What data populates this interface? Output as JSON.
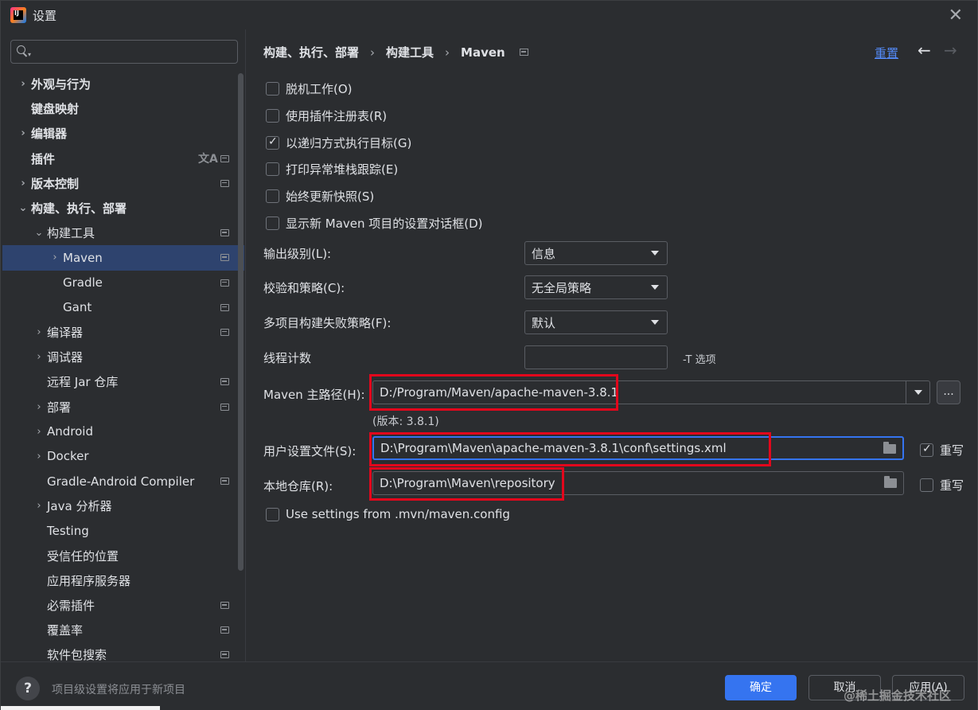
{
  "window": {
    "title": "设置",
    "logo_text": "IJ"
  },
  "sidebar": {
    "search_placeholder": "",
    "items": [
      {
        "label": "外观与行为",
        "chevron": "›",
        "bold": true
      },
      {
        "label": "键盘映射",
        "chevron": "",
        "bold": true
      },
      {
        "label": "编辑器",
        "chevron": "›",
        "bold": true
      },
      {
        "label": "插件",
        "chevron": "",
        "bold": true
      },
      {
        "label": "版本控制",
        "chevron": "›",
        "bold": true
      },
      {
        "label": "构建、执行、部署",
        "chevron": "⌄",
        "bold": true
      },
      {
        "label": "构建工具",
        "chevron": "⌄",
        "bold": false
      },
      {
        "label": "Maven",
        "chevron": "›",
        "bold": false
      },
      {
        "label": "Gradle",
        "chevron": "",
        "bold": false
      },
      {
        "label": "Gant",
        "chevron": "",
        "bold": false
      },
      {
        "label": "编译器",
        "chevron": "›",
        "bold": false
      },
      {
        "label": "调试器",
        "chevron": "›",
        "bold": false
      },
      {
        "label": "远程 Jar 仓库",
        "chevron": "",
        "bold": false
      },
      {
        "label": "部署",
        "chevron": "›",
        "bold": false
      },
      {
        "label": "Android",
        "chevron": "›",
        "bold": false
      },
      {
        "label": "Docker",
        "chevron": "›",
        "bold": false
      },
      {
        "label": "Gradle-Android Compiler",
        "chevron": "",
        "bold": false
      },
      {
        "label": "Java 分析器",
        "chevron": "›",
        "bold": false
      },
      {
        "label": "Testing",
        "chevron": "",
        "bold": false
      },
      {
        "label": "受信任的位置",
        "chevron": "",
        "bold": false
      },
      {
        "label": "应用程序服务器",
        "chevron": "",
        "bold": false
      },
      {
        "label": "必需插件",
        "chevron": "",
        "bold": false
      },
      {
        "label": "覆盖率",
        "chevron": "",
        "bold": false
      },
      {
        "label": "软件包搜索",
        "chevron": "",
        "bold": false
      }
    ],
    "translate_glyph": "文A"
  },
  "main": {
    "breadcrumb": [
      "构建、执行、部署",
      "构建工具",
      "Maven"
    ],
    "breadcrumb_sep": "›",
    "reset_label": "重置",
    "back_glyph": "←",
    "forward_glyph": "→",
    "checkboxes": [
      {
        "label": "脱机工作(O)",
        "checked": false
      },
      {
        "label": "使用插件注册表(R)",
        "checked": false
      },
      {
        "label": "以递归方式执行目标(G)",
        "checked": true
      },
      {
        "label": "打印异常堆栈跟踪(E)",
        "checked": false
      },
      {
        "label": "始终更新快照(S)",
        "checked": false
      },
      {
        "label": "显示新 Maven 项目的设置对话框(D)",
        "checked": false
      }
    ],
    "output_level": {
      "label": "输出级别(L):",
      "value": "信息"
    },
    "checksum_policy": {
      "label": "校验和策略(C):",
      "value": "无全局策略"
    },
    "multiproject_fail": {
      "label": "多项目构建失败策略(F):",
      "value": "默认"
    },
    "thread_count": {
      "label": "线程计数",
      "value": "",
      "hint": "-T 选项"
    },
    "maven_home": {
      "label": "Maven 主路径(H):",
      "value": "D:/Program/Maven/apache-maven-3.8.1",
      "browse": "...",
      "version": "(版本: 3.8.1)"
    },
    "user_settings": {
      "label": "用户设置文件(S):",
      "value": "D:\\Program\\Maven\\apache-maven-3.8.1\\conf\\settings.xml",
      "override_label": "重写",
      "override_checked": true
    },
    "local_repo": {
      "label": "本地仓库(R):",
      "value": "D:\\Program\\Maven\\repository",
      "override_label": "重写",
      "override_checked": false
    },
    "mvn_config": {
      "label": "Use settings from .mvn/maven.config",
      "checked": false
    }
  },
  "footer": {
    "help_glyph": "?",
    "note": "项目级设置将应用于新项目",
    "ok_label": "确定",
    "cancel_label": "取消",
    "apply_label": "应用(A)",
    "watermark": "@稀土掘金技术社区"
  },
  "colors": {
    "accent": "#3574f0",
    "highlight_box": "#e2071c",
    "link": "#548af7",
    "selection": "#2e436e"
  }
}
